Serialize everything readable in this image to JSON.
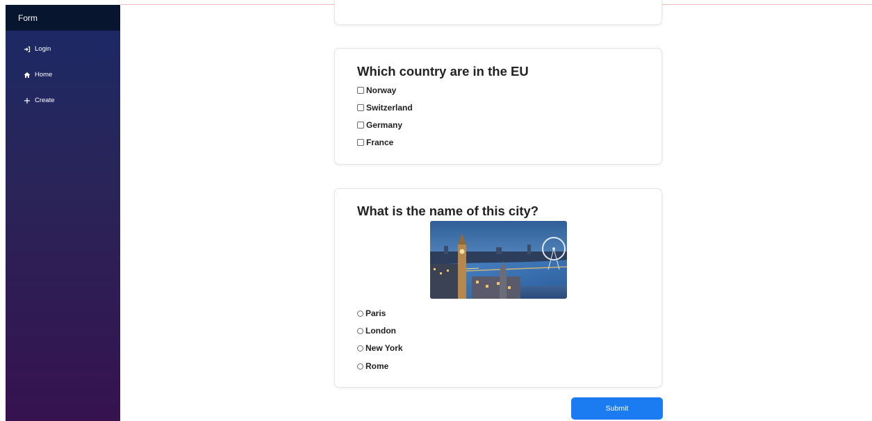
{
  "sidebar": {
    "title": "Form",
    "items": [
      {
        "label": "Login",
        "icon": "login-icon"
      },
      {
        "label": "Home",
        "icon": "home-icon"
      },
      {
        "label": "Create",
        "icon": "plus-icon"
      }
    ],
    "colors": {
      "header": "#07152e",
      "gradient_top": "#1b2a66",
      "gradient_bottom": "#36124f"
    }
  },
  "questions": [
    {
      "title": "Which country are in the EU",
      "type": "checkbox",
      "options": [
        "Norway",
        "Switzerland",
        "Germany",
        "France"
      ]
    },
    {
      "title": "What is the name of this city?",
      "type": "radio",
      "image": "london-skyline-image",
      "options": [
        "Paris",
        "London",
        "New York",
        "Rome"
      ]
    }
  ],
  "submit": {
    "label": "Submit",
    "color": "#1a7cf0"
  }
}
